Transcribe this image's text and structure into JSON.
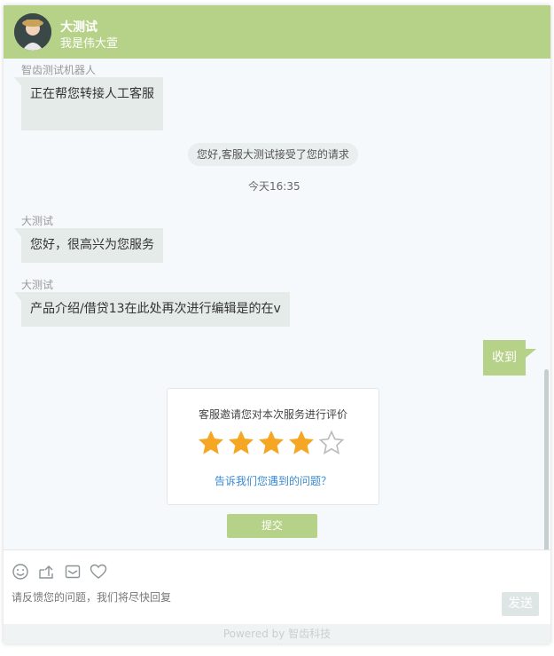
{
  "header": {
    "agent_name": "大测试",
    "agent_signature": "我是伟大萱"
  },
  "messages": {
    "bot": {
      "sender": "智齿测试机器人",
      "text": "正在帮您转接人工客服"
    },
    "system_notice": "您好,客服大测试接受了您的请求",
    "timestamp": "今天16:35",
    "agent1": {
      "sender": "大测试",
      "text": "您好，很高兴为您服务"
    },
    "agent2": {
      "sender": "大测试",
      "text": "产品介绍/借贷13在此处再次进行编辑是的在v"
    },
    "user": {
      "text": "收到"
    }
  },
  "rating": {
    "title": "客服邀请您对本次服务进行评价",
    "stars_selected": 4,
    "stars_total": 5,
    "feedback_link": "告诉我们您遇到的问题？",
    "submit_label": "提交"
  },
  "composer": {
    "tools": [
      "smile-icon",
      "upload-icon",
      "mail-icon",
      "heart-icon"
    ],
    "placeholder": "请反馈您的问题，我们将尽快回复",
    "send_label": "发送"
  },
  "footer": {
    "text": "Powered by 智齿科技"
  },
  "colors": {
    "brand": "#b6d188",
    "star_filled": "#f5a623",
    "star_empty": "#bbbbbb",
    "link": "#3a8ad0"
  }
}
